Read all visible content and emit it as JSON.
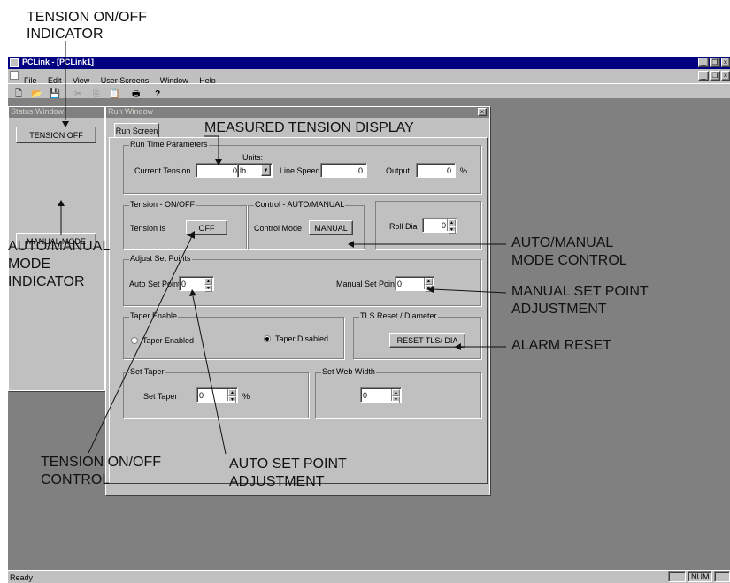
{
  "callouts": {
    "tension_indicator_line1": "TENSION ON/OFF",
    "tension_indicator_line2": "INDICATOR",
    "measured_tension": "MEASURED TENSION DISPLAY",
    "automanual_indicator_line1": "AUTO/MANUAL",
    "automanual_indicator_line2": "MODE",
    "automanual_indicator_line3": "INDICATOR",
    "automanual_control_line1": "AUTO/MANUAL",
    "automanual_control_line2": "MODE CONTROL",
    "manual_setpoint_line1": "MANUAL SET POINT",
    "manual_setpoint_line2": "ADJUSTMENT",
    "alarm_reset": "ALARM RESET",
    "tension_control_line1": "TENSION ON/OFF",
    "tension_control_line2": "CONTROL",
    "auto_setpoint_line1": "AUTO SET POINT",
    "auto_setpoint_line2": "ADJUSTMENT"
  },
  "app": {
    "title": "PCLink - [PCLink1]",
    "menu": [
      "File",
      "Edit",
      "View",
      "User Screens",
      "Window",
      "Help"
    ],
    "status_bar": {
      "left": "Ready",
      "num": "NUM"
    }
  },
  "status_window": {
    "title": "Status Window",
    "tension_button": "TENSION OFF",
    "mode_button": "MANUAL MODE"
  },
  "run_window": {
    "title": "Run Window",
    "tab": "Run Screen",
    "run_time": {
      "group_title": "Run Time Parameters",
      "current_tension_label": "Current Tension",
      "current_tension_value": "0",
      "units_label": "Units:",
      "units_value": "lb",
      "line_speed_label": "Line Speed",
      "line_speed_value": "0",
      "output_label": "Output",
      "output_value": "0",
      "output_unit": "%"
    },
    "tension": {
      "group_title": "Tension - ON/OFF",
      "label": "Tension is",
      "button": "OFF"
    },
    "control": {
      "group_title": "Control - AUTO/MANUAL",
      "label": "Control Mode",
      "button": "MANUAL"
    },
    "roll": {
      "label": "Roll Dia",
      "value": "0"
    },
    "set_points": {
      "group_title": "Adjust Set Points",
      "auto_label": "Auto Set Point",
      "auto_value": "0",
      "manual_label": "Manual Set Point",
      "manual_value": "0"
    },
    "taper_enable": {
      "group_title": "Taper Enable",
      "enabled_label": "Taper Enabled",
      "disabled_label": "Taper Disabled"
    },
    "tls": {
      "group_title": "TLS Reset / Diameter",
      "button": "RESET TLS/ DIA"
    },
    "set_taper": {
      "group_title": "Set Taper",
      "label": "Set Taper",
      "value": "0",
      "unit": "%"
    },
    "web_width": {
      "group_title": "Set Web Width",
      "value": "0"
    }
  }
}
